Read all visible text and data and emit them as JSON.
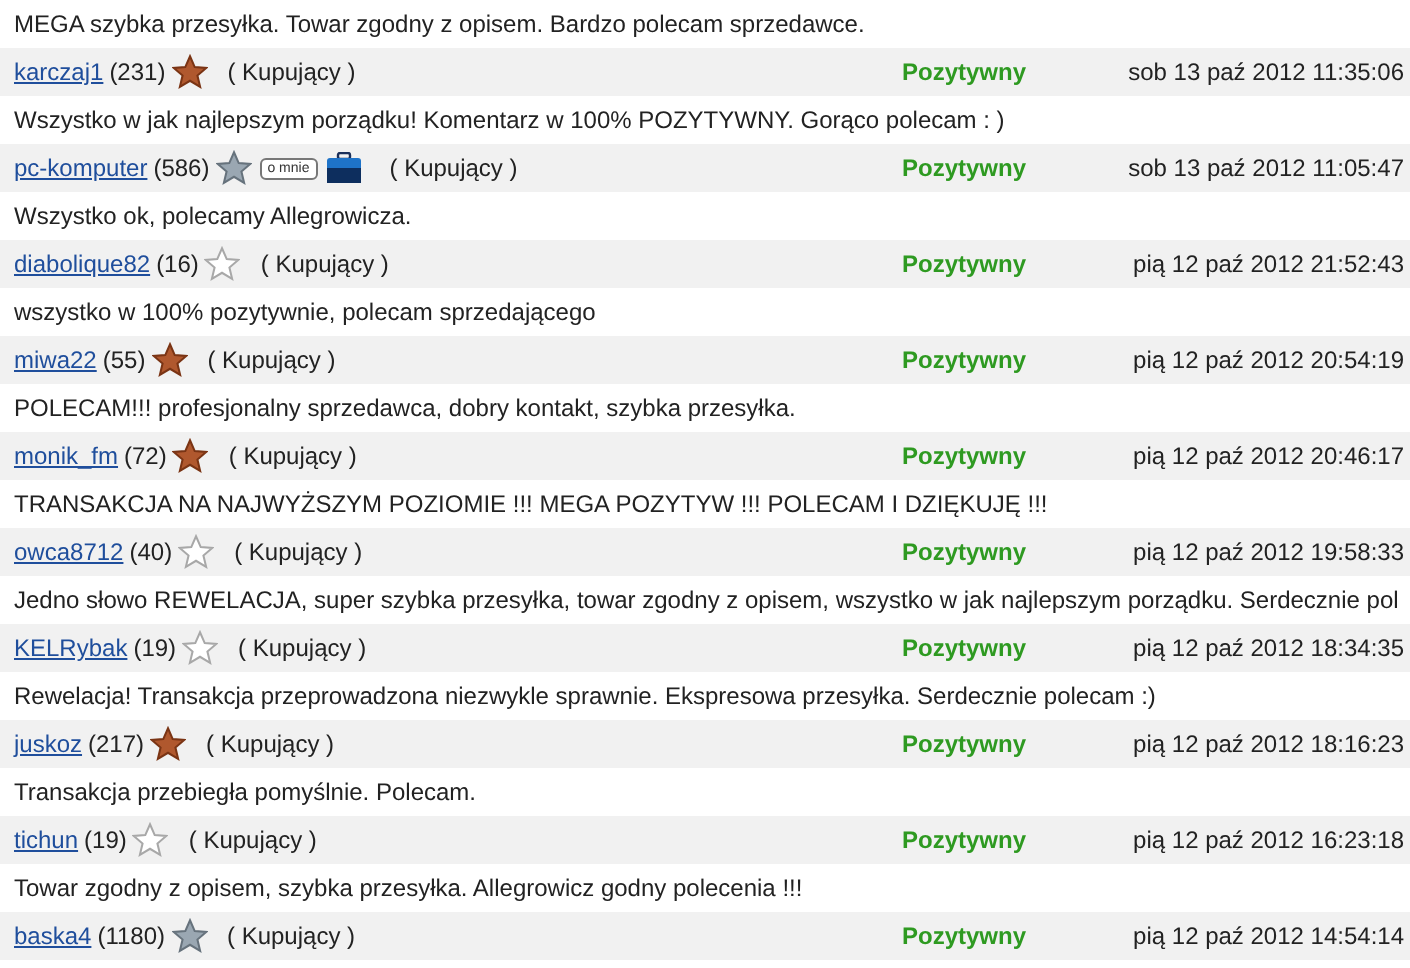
{
  "leading_comment": "MEGA szybka przesyłka. Towar zgodny z opisem. Bardzo polecam sprzedawce.",
  "entries": [
    {
      "user": "karczaj1",
      "score": "(231)",
      "kind": "bronze",
      "role": "( Kupujący )",
      "rating": "Pozytywny",
      "date": "sob 13 paź 2012 11:35:06",
      "comment": "Wszystko w jak najlepszym porządku! Komentarz w 100% POZYTYWNY. Gorąco polecam : )"
    },
    {
      "user": "pc-komputer",
      "score": "(586)",
      "kind": "silver",
      "about_badge": "o mnie",
      "shop_icon": true,
      "role": "( Kupujący )",
      "rating": "Pozytywny",
      "date": "sob 13 paź 2012 11:05:47",
      "comment": "Wszystko ok, polecamy Allegrowicza."
    },
    {
      "user": "diabolique82",
      "score": "(16)",
      "kind": "plain",
      "role": "( Kupujący )",
      "rating": "Pozytywny",
      "date": "pią 12 paź 2012 21:52:43",
      "comment": "wszystko w 100% pozytywnie, polecam sprzedającego"
    },
    {
      "user": "miwa22",
      "score": "(55)",
      "kind": "bronze",
      "role": "( Kupujący )",
      "rating": "Pozytywny",
      "date": "pią 12 paź 2012 20:54:19",
      "comment": "POLECAM!!! profesjonalny sprzedawca, dobry kontakt, szybka przesyłka."
    },
    {
      "user": "monik_fm",
      "score": "(72)",
      "kind": "bronze",
      "role": "( Kupujący )",
      "rating": "Pozytywny",
      "date": "pią 12 paź 2012 20:46:17",
      "comment": "TRANSAKCJA NA NAJWYŻSZYM POZIOMIE !!! MEGA POZYTYW !!! POLECAM I DZIĘKUJĘ !!!"
    },
    {
      "user": "owca8712",
      "score": "(40)",
      "kind": "plain",
      "role": "( Kupujący )",
      "rating": "Pozytywny",
      "date": "pią 12 paź 2012 19:58:33",
      "comment": "Jedno słowo REWELACJA, super szybka przesyłka, towar zgodny z opisem, wszystko w jak najlepszym porządku. Serdecznie pol"
    },
    {
      "user": "KELRybak",
      "score": "(19)",
      "kind": "plain",
      "role": "( Kupujący )",
      "rating": "Pozytywny",
      "date": "pią 12 paź 2012 18:34:35",
      "comment": "Rewelacja! Transakcja przeprowadzona niezwykle sprawnie. Ekspresowa przesyłka. Serdecznie polecam :)"
    },
    {
      "user": "juskoz",
      "score": "(217)",
      "kind": "bronze",
      "role": "( Kupujący )",
      "rating": "Pozytywny",
      "date": "pią 12 paź 2012 18:16:23",
      "comment": "Transakcja przebiegła pomyślnie. Polecam."
    },
    {
      "user": "tichun",
      "score": "(19)",
      "kind": "plain",
      "role": "( Kupujący )",
      "rating": "Pozytywny",
      "date": "pią 12 paź 2012 16:23:18",
      "comment": "Towar zgodny z opisem, szybka przesyłka. Allegrowicz godny polecenia !!!"
    },
    {
      "user": "baska4",
      "score": "(1180)",
      "kind": "silver",
      "role": "( Kupujący )",
      "rating": "Pozytywny",
      "date": "pią 12 paź 2012 14:54:14"
    }
  ]
}
